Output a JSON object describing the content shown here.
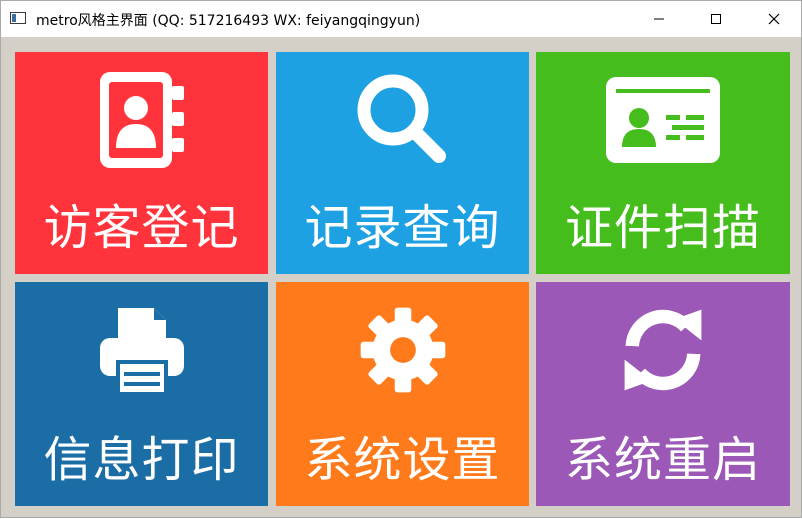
{
  "window": {
    "title": "metro风格主界面 (QQ: 517216493 WX: feiyangqingyun)",
    "controls": {
      "minimize": "minimize-icon",
      "maximize": "maximize-icon",
      "close": "close-icon"
    }
  },
  "tiles": [
    {
      "label": "访客登记",
      "icon": "address-book-icon",
      "color": "#ff333b"
    },
    {
      "label": "记录查询",
      "icon": "search-icon",
      "color": "#1ea1e2"
    },
    {
      "label": "证件扫描",
      "icon": "id-card-icon",
      "color": "#45bd1d"
    },
    {
      "label": "信息打印",
      "icon": "printer-icon",
      "color": "#1b6ea5"
    },
    {
      "label": "系统设置",
      "icon": "gear-icon",
      "color": "#ff7a1b"
    },
    {
      "label": "系统重启",
      "icon": "refresh-icon",
      "color": "#9b58b6"
    }
  ]
}
